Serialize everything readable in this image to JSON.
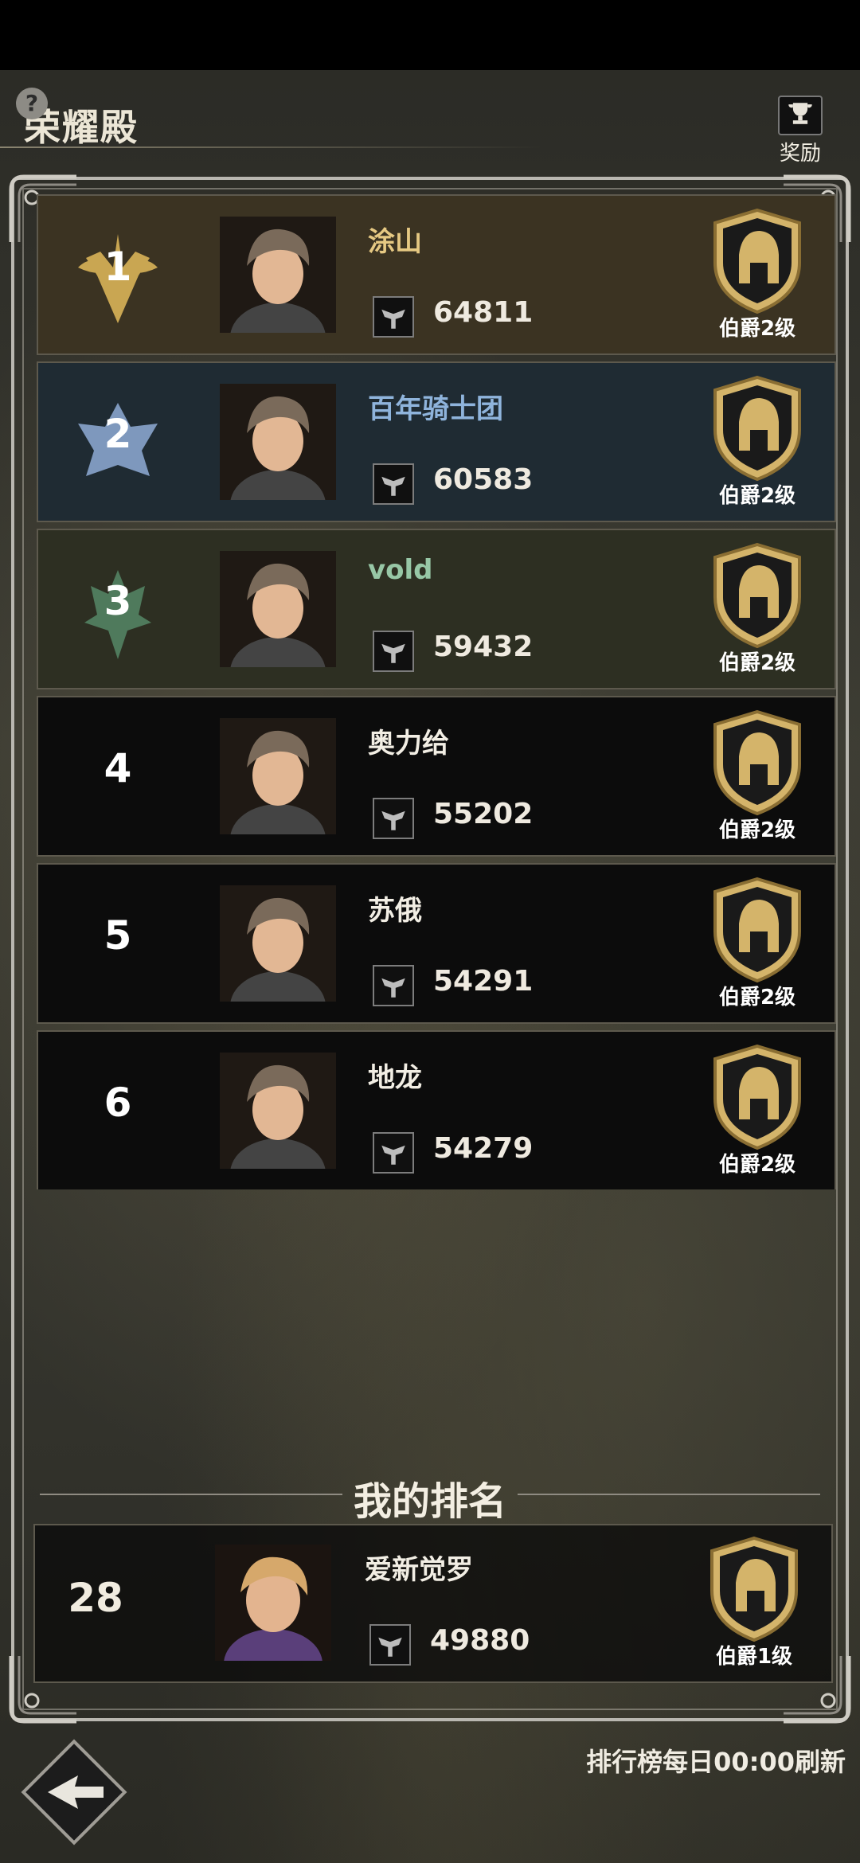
{
  "header": {
    "title": "荣耀殿",
    "help_label": "?",
    "reward_label": "奖励"
  },
  "ranking": [
    {
      "rank": "1",
      "name": "涂山",
      "power": "64811",
      "title": "伯爵2级",
      "name_color": "#e6c983",
      "bg": "#3b3322",
      "crest": "gold"
    },
    {
      "rank": "2",
      "name": "百年骑士团",
      "power": "60583",
      "title": "伯爵2级",
      "name_color": "#8fb4dc",
      "bg": "#1f2b33",
      "crest": "blue"
    },
    {
      "rank": "3",
      "name": "vold",
      "power": "59432",
      "title": "伯爵2级",
      "name_color": "#97c7a6",
      "bg": "#2d2f22",
      "crest": "green"
    },
    {
      "rank": "4",
      "name": "奥力给",
      "power": "55202",
      "title": "伯爵2级",
      "name_color": "#f2eee4",
      "bg": "#0c0c0c",
      "crest": "none"
    },
    {
      "rank": "5",
      "name": "苏俄",
      "power": "54291",
      "title": "伯爵2级",
      "name_color": "#f2eee4",
      "bg": "#0c0c0c",
      "crest": "none"
    },
    {
      "rank": "6",
      "name": "地龙",
      "power": "54279",
      "title": "伯爵2级",
      "name_color": "#f2eee4",
      "bg": "#0c0c0c",
      "crest": "none"
    }
  ],
  "my_rank": {
    "section_title": "我的排名",
    "rank": "28",
    "name": "爱新觉罗",
    "power": "49880",
    "title": "伯爵1级"
  },
  "footer": {
    "refresh_note": "排行榜每日00:00刷新"
  },
  "colors": {
    "gold": "#d4b46a",
    "frame": "#b9b7b0"
  }
}
